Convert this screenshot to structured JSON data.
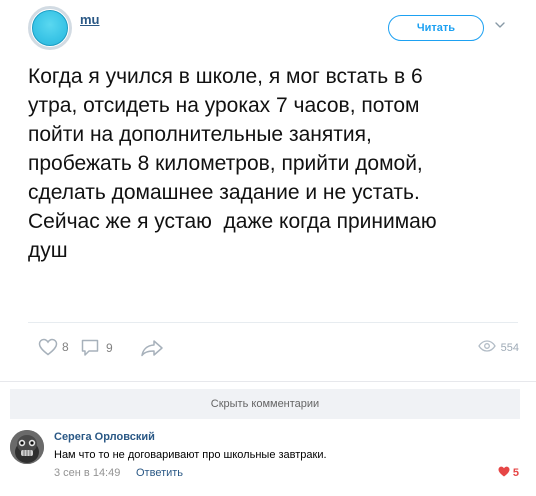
{
  "post": {
    "author": "mu",
    "follow_label": "Читать",
    "text": "Когда я учился в школе, я мог встать в 6\nутра, отсидеть на уроках 7 часов, потом\nпойти на дополнительные занятия,\nпробежать 8 километров, прийти домой,\nсделать домашнее задание и не устать.\nСейчас же я устаю  даже когда принимаю\nдуш",
    "likes": "8",
    "comments": "9",
    "views": "554"
  },
  "comments_section": {
    "hide_label": "Скрыть комментарии",
    "items": [
      {
        "name": "Серега Орловский",
        "text": "Нам что то не договаривают про школьные завтраки.",
        "date": "3 сен в 14:49",
        "reply_label": "Ответить",
        "likes": "5"
      }
    ]
  },
  "colors": {
    "link": "#2a5885",
    "twitter_blue": "#1da1f2",
    "like_red": "#e64646",
    "muted": "#939393"
  }
}
